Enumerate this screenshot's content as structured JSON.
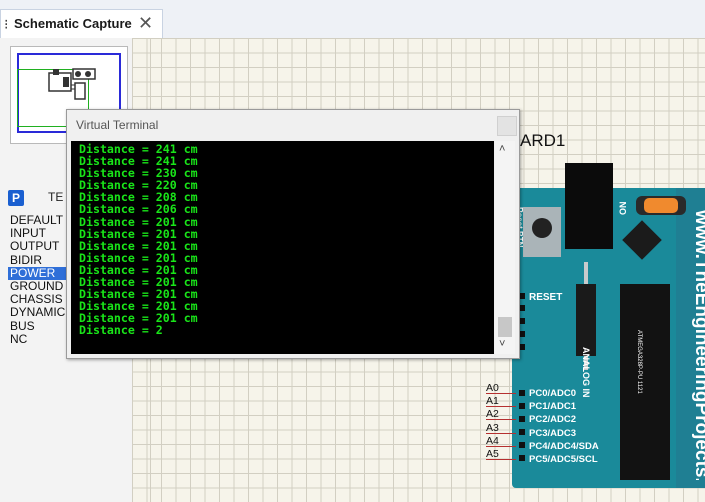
{
  "tab": {
    "icon": "schematic-icon",
    "label": "Schematic Capture",
    "close_icon": "close-icon"
  },
  "left_panel": {
    "badge": "P",
    "section_label": "TE",
    "terminals": [
      "DEFAULT",
      "INPUT",
      "OUTPUT",
      "BIDIR",
      "POWER",
      "GROUND",
      "CHASSIS",
      "DYNAMIC",
      "BUS",
      "NC"
    ],
    "selected": "POWER"
  },
  "board": {
    "ref_label": "ARD1",
    "url": "www.TheEngineeringProjects.com",
    "reset_rtn": "Reset BTN",
    "on_label": "ON",
    "reset_label": "RESET",
    "analog_label": "ANALOG IN",
    "pin_labels": [
      "PC0/ADC0",
      "PC1/ADC1",
      "PC2/ADC2",
      "PC3/ADC3",
      "PC4/ADC4/SDA",
      "PC5/ADC5/SCL"
    ],
    "a_labels": [
      "A0",
      "A1",
      "A2",
      "A3",
      "A4",
      "A5"
    ],
    "mcu_text": "ATMEGA328P-PU 1121"
  },
  "virtual_terminal": {
    "title": "Virtual Terminal",
    "lines": [
      "Distance = 241 cm",
      "Distance = 241 cm",
      "Distance = 230 cm",
      "Distance = 220 cm",
      "Distance = 208 cm",
      "Distance = 206 cm",
      "Distance = 201 cm",
      "Distance = 201 cm",
      "Distance = 201 cm",
      "Distance = 201 cm",
      "Distance = 201 cm",
      "Distance = 201 cm",
      "Distance = 201 cm",
      "Distance = 201 cm",
      "Distance = 201 cm",
      "Distance = 2"
    ],
    "text_color": "#19e519"
  },
  "colors": {
    "board": "#1a8a9a",
    "selection": "#2f6fd8",
    "grid": "#d2cfc2"
  }
}
